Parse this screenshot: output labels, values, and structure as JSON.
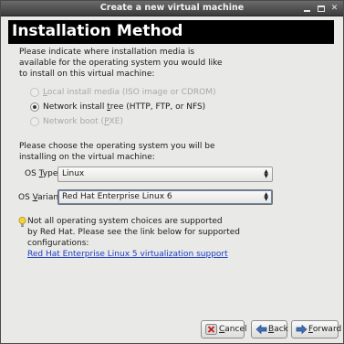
{
  "window": {
    "title": "Create a new virtual machine"
  },
  "header": {
    "title": "Installation Method"
  },
  "intro": {
    "line1": "Please indicate where installation media is",
    "line2": "available for the operating system you would like",
    "line3": "to install on this virtual machine:"
  },
  "install_options": [
    {
      "label_pre": "",
      "label_u": "L",
      "label_post": "ocal install media (ISO image or CDROM)",
      "enabled": false,
      "selected": false
    },
    {
      "label_pre": "Network install ",
      "label_u": "t",
      "label_post": "ree (HTTP, FTP, or NFS)",
      "enabled": true,
      "selected": true
    },
    {
      "label_pre": "Network boot (",
      "label_u": "P",
      "label_post": "XE)",
      "enabled": false,
      "selected": false
    }
  ],
  "os_choice": {
    "line1": "Please choose the operating system you will be",
    "line2": "installing on the virtual machine:",
    "type_label_pre": "OS ",
    "type_label_u": "T",
    "type_label_post": "ype:",
    "type_value": "Linux",
    "variant_label_pre": "OS ",
    "variant_label_u": "V",
    "variant_label_post": "ariant:",
    "variant_value": "Red Hat Enterprise Linux 6"
  },
  "note": {
    "line1": "Not all operating system choices are supported",
    "line2": "by Red Hat. Please see the link below for supported",
    "line3": "configurations:",
    "link": "Red Hat Enterprise Linux 5 virtualization support"
  },
  "buttons": {
    "cancel_u": "C",
    "cancel_rest": "ancel",
    "back_u": "B",
    "back_rest": "ack",
    "forward_u": "F",
    "forward_rest": "orward"
  },
  "colors": {
    "header_bg": "#000000",
    "link": "#1f3ec7",
    "window_bg": "#e9e9e7"
  },
  "icons": [
    "minimize-icon",
    "maximize-icon",
    "close-icon",
    "lightbulb-icon",
    "cancel-icon",
    "back-arrow-icon",
    "forward-arrow-icon"
  ]
}
